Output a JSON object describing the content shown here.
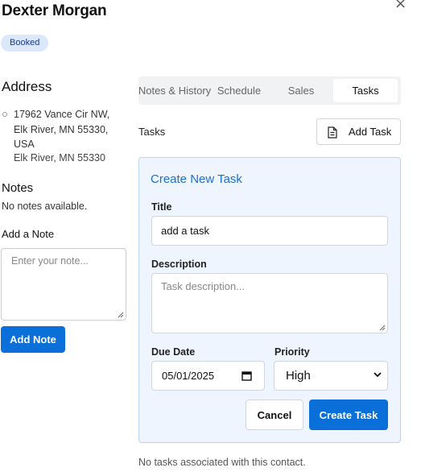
{
  "window": {
    "close_glyph": "×"
  },
  "contact": {
    "name": "Dexter Morgan",
    "status_badge": "Booked",
    "address_heading": "Address",
    "address_street_city": "17962 Vance Cir NW, Elk River, MN 55330, USA",
    "address_secondary": "Elk River, MN 55330"
  },
  "notes": {
    "heading": "Notes",
    "empty_text": "No notes available.",
    "add_heading": "Add a Note",
    "input_placeholder": "Enter your note...",
    "input_value": "",
    "add_button": "Add Note"
  },
  "tabs": [
    {
      "label": "Notes & History",
      "active": false
    },
    {
      "label": "Schedule",
      "active": false
    },
    {
      "label": "Sales",
      "active": false
    },
    {
      "label": "Tasks",
      "active": true
    }
  ],
  "tasks": {
    "heading": "Tasks",
    "add_button": "Add Task",
    "empty_text": "No tasks associated with this contact."
  },
  "new_task_form": {
    "title": "Create New Task",
    "title_label": "Title",
    "title_value": "add a task",
    "description_label": "Description",
    "description_placeholder": "Task description...",
    "description_value": "",
    "due_date_label": "Due Date",
    "due_date_value": "05/01/2025",
    "priority_label": "Priority",
    "priority_value": "High",
    "cancel_button": "Cancel",
    "create_button": "Create Task"
  },
  "icons": {
    "close": "close-icon",
    "address_pin": "map-pin-icon",
    "add_task": "document-icon",
    "date": "calendar-icon",
    "priority": "chevron-down-icon",
    "resize": "resize-grip-icon"
  },
  "colors": {
    "primary": "#0a6fd8",
    "badge_bg": "#dbe7fb",
    "card_bg": "#eef5fe",
    "card_border": "#b9d5f4",
    "card_title": "#1d6fcf"
  }
}
